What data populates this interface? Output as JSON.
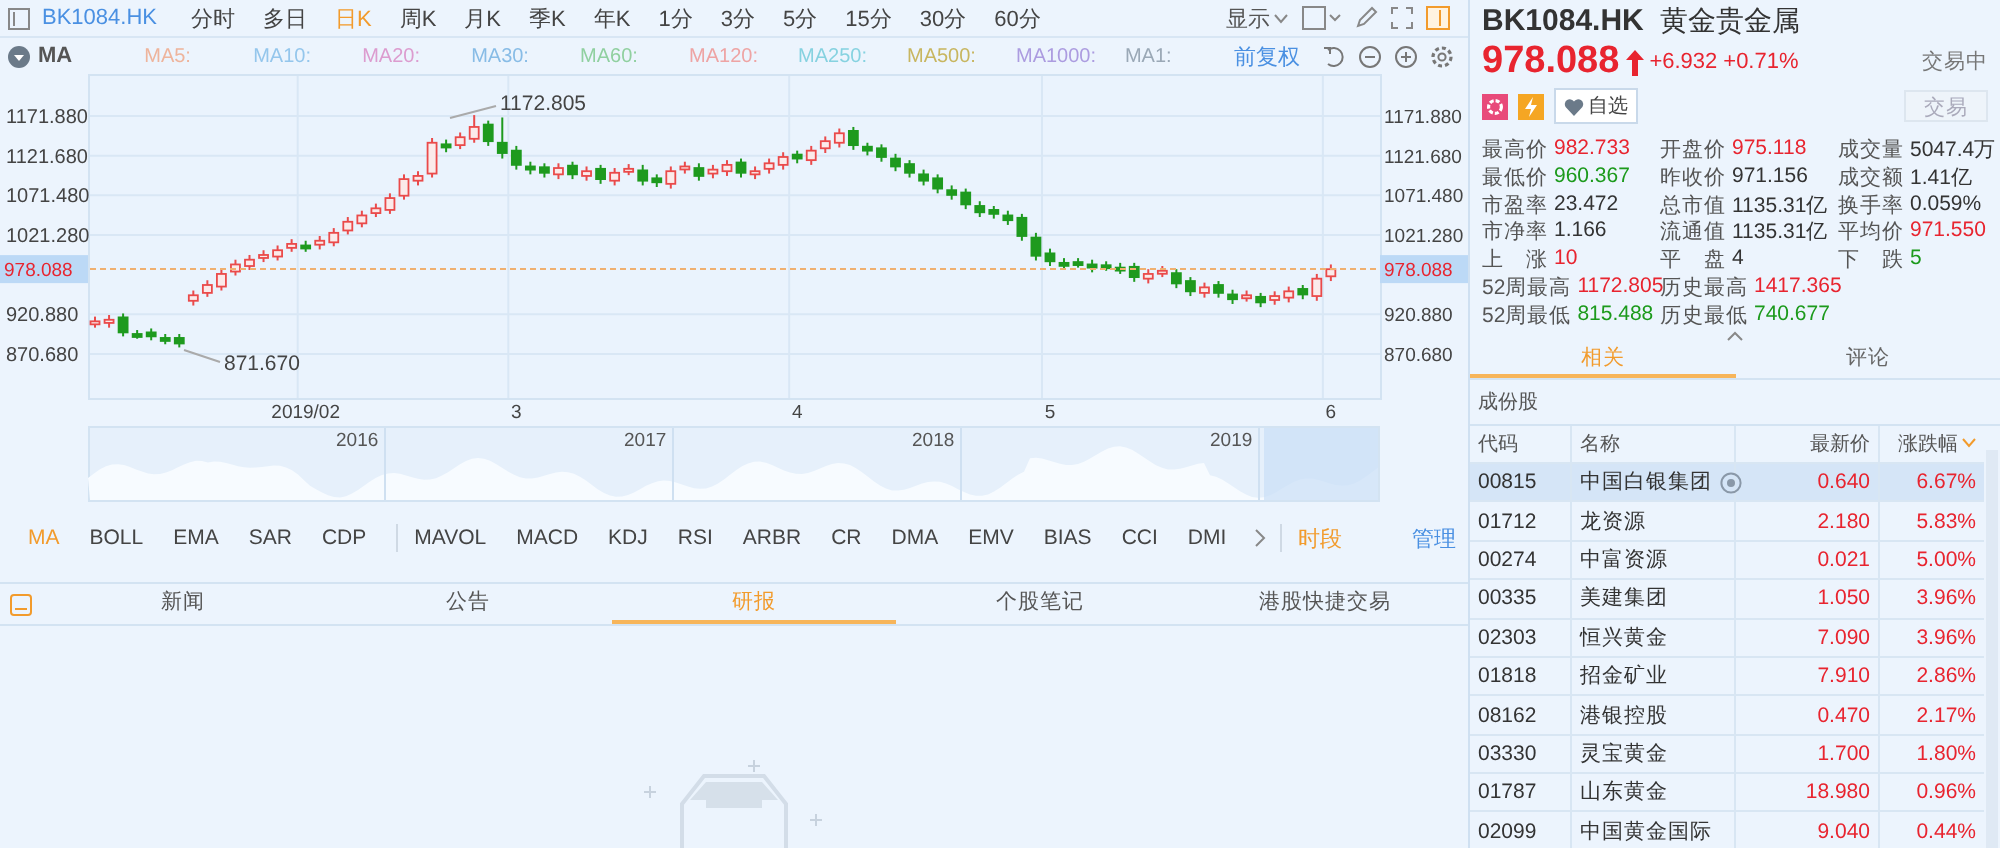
{
  "toolbar": {
    "symbol": "BK1084.HK",
    "periods": [
      {
        "label": "分时",
        "selected": false
      },
      {
        "label": "多日",
        "selected": false
      },
      {
        "label": "日K",
        "selected": true
      },
      {
        "label": "周K",
        "selected": false
      },
      {
        "label": "月K",
        "selected": false
      },
      {
        "label": "季K",
        "selected": false
      },
      {
        "label": "年K",
        "selected": false
      },
      {
        "label": "1分",
        "selected": false
      },
      {
        "label": "3分",
        "selected": false
      },
      {
        "label": "5分",
        "selected": false
      },
      {
        "label": "15分",
        "selected": false
      },
      {
        "label": "30分",
        "selected": false
      },
      {
        "label": "60分",
        "selected": false
      }
    ],
    "display_menu": "显示"
  },
  "ma_legend": {
    "label": "MA",
    "adjust": "前复权",
    "items": [
      {
        "label": "MA5:",
        "color": "#eeb49c"
      },
      {
        "label": "MA10:",
        "color": "#94c6ec"
      },
      {
        "label": "MA20:",
        "color": "#dc9ccf"
      },
      {
        "label": "MA30:",
        "color": "#88bce6"
      },
      {
        "label": "MA60:",
        "color": "#90d0a0"
      },
      {
        "label": "MA120:",
        "color": "#eea4a4"
      },
      {
        "label": "MA250:",
        "color": "#86d2e0"
      },
      {
        "label": "MA500:",
        "color": "#c8b660"
      },
      {
        "label": "MA1000:",
        "color": "#ac9ce0"
      },
      {
        "label": "MA1:",
        "color": "#9aa8b6"
      }
    ]
  },
  "chart": {
    "high_label": "1172.805",
    "low_label": "871.670",
    "price_tags": [
      "978.088",
      "978.088"
    ],
    "right_axis_labels": [
      "1171.880",
      "1121.680",
      "1071.480",
      "1021.280",
      "920.880",
      "870.680"
    ],
    "chart_data": {
      "type": "candlestick",
      "categories": [
        null,
        null,
        null,
        null,
        null,
        null,
        null,
        null,
        null,
        null,
        null,
        null,
        null,
        null,
        null,
        "2019/02",
        null,
        null,
        null,
        null,
        null,
        null,
        null,
        null,
        null,
        null,
        null,
        null,
        null,
        null,
        "3",
        null,
        null,
        null,
        null,
        null,
        null,
        null,
        null,
        null,
        null,
        null,
        null,
        null,
        null,
        null,
        null,
        null,
        null,
        null,
        "4",
        null,
        null,
        null,
        null,
        null,
        null,
        null,
        null,
        null,
        null,
        null,
        null,
        null,
        null,
        null,
        null,
        null,
        "5",
        null,
        null,
        null,
        null,
        null,
        null,
        null,
        null,
        null,
        null,
        null,
        null,
        null,
        null,
        null,
        null,
        null,
        null,
        null,
        "6"
      ],
      "ylim": [
        815.0,
        1225.0
      ],
      "grid": true,
      "ref_lines": [
        {
          "axis": "y",
          "value": 978.088,
          "color": "#f0b070"
        }
      ],
      "ohlc": [
        [
          910,
          918,
          904,
          912
        ],
        [
          910,
          920,
          904,
          914
        ],
        [
          917,
          922,
          893,
          898
        ],
        [
          896,
          901,
          890,
          895
        ],
        [
          898,
          903,
          888,
          893
        ],
        [
          891,
          896,
          883,
          888
        ],
        [
          891,
          896,
          879,
          884
        ],
        [
          938,
          951,
          932,
          945
        ],
        [
          948,
          964,
          943,
          958
        ],
        [
          956,
          978,
          951,
          972
        ],
        [
          975,
          990,
          970,
          984
        ],
        [
          982,
          996,
          977,
          990
        ],
        [
          993,
          1002,
          987,
          996
        ],
        [
          994,
          1008,
          989,
          1002
        ],
        [
          1005,
          1016,
          1000,
          1010
        ],
        [
          1008,
          1014,
          1000,
          1006
        ],
        [
          1009,
          1020,
          1003,
          1014
        ],
        [
          1012,
          1030,
          1007,
          1024
        ],
        [
          1027,
          1044,
          1022,
          1038
        ],
        [
          1036,
          1052,
          1031,
          1046
        ],
        [
          1049,
          1061,
          1044,
          1055
        ],
        [
          1053,
          1074,
          1048,
          1068
        ],
        [
          1071,
          1098,
          1066,
          1092
        ],
        [
          1090,
          1102,
          1084,
          1096
        ],
        [
          1099,
          1144,
          1094,
          1138
        ],
        [
          1136,
          1142,
          1126,
          1132
        ],
        [
          1135,
          1151,
          1130,
          1145
        ],
        [
          1143,
          1173,
          1138,
          1158
        ],
        [
          1161,
          1166,
          1134,
          1140
        ],
        [
          1138,
          1170,
          1118,
          1125
        ],
        [
          1128,
          1134,
          1104,
          1110
        ],
        [
          1108,
          1114,
          1098,
          1104
        ],
        [
          1107,
          1112,
          1094,
          1100
        ],
        [
          1098,
          1112,
          1092,
          1106
        ],
        [
          1109,
          1114,
          1092,
          1098
        ],
        [
          1096,
          1108,
          1090,
          1102
        ],
        [
          1105,
          1110,
          1086,
          1092
        ],
        [
          1090,
          1106,
          1084,
          1100
        ],
        [
          1103,
          1111,
          1097,
          1105
        ],
        [
          1103,
          1110,
          1084,
          1090
        ],
        [
          1093,
          1098,
          1082,
          1088
        ],
        [
          1086,
          1108,
          1080,
          1102
        ],
        [
          1105,
          1114,
          1099,
          1108
        ],
        [
          1106,
          1112,
          1090,
          1096
        ],
        [
          1099,
          1110,
          1093,
          1104
        ],
        [
          1102,
          1116,
          1096,
          1110
        ],
        [
          1113,
          1118,
          1094,
          1100
        ],
        [
          1098,
          1108,
          1092,
          1102
        ],
        [
          1105,
          1118,
          1099,
          1112
        ],
        [
          1110,
          1126,
          1104,
          1120
        ],
        [
          1123,
          1128,
          1112,
          1118
        ],
        [
          1116,
          1134,
          1110,
          1128
        ],
        [
          1131,
          1146,
          1125,
          1140
        ],
        [
          1138,
          1156,
          1132,
          1150
        ],
        [
          1153,
          1158,
          1129,
          1135
        ],
        [
          1133,
          1138,
          1122,
          1128
        ],
        [
          1131,
          1136,
          1114,
          1120
        ],
        [
          1118,
          1124,
          1102,
          1108
        ],
        [
          1111,
          1116,
          1094,
          1100
        ],
        [
          1098,
          1104,
          1084,
          1090
        ],
        [
          1093,
          1098,
          1074,
          1080
        ],
        [
          1078,
          1084,
          1066,
          1072
        ],
        [
          1075,
          1080,
          1054,
          1060
        ],
        [
          1058,
          1064,
          1044,
          1050
        ],
        [
          1053,
          1058,
          1042,
          1048
        ],
        [
          1046,
          1052,
          1034,
          1040
        ],
        [
          1043,
          1048,
          1014,
          1020
        ],
        [
          1018,
          1024,
          989,
          995
        ],
        [
          998,
          1004,
          982,
          988
        ],
        [
          986,
          992,
          978,
          984
        ],
        [
          987,
          992,
          980,
          986
        ],
        [
          984,
          990,
          974,
          980
        ],
        [
          983,
          988,
          976,
          982
        ],
        [
          980,
          986,
          972,
          978
        ],
        [
          981,
          986,
          962,
          968
        ],
        [
          966,
          978,
          960,
          972
        ],
        [
          974,
          982,
          968,
          976
        ],
        [
          973,
          978,
          954,
          960
        ],
        [
          963,
          968,
          944,
          950
        ],
        [
          948,
          961,
          942,
          955
        ],
        [
          958,
          963,
          942,
          948
        ],
        [
          946,
          952,
          934,
          940
        ],
        [
          943,
          951,
          937,
          945
        ],
        [
          943,
          948,
          930,
          936
        ],
        [
          939,
          950,
          933,
          944
        ],
        [
          942,
          956,
          936,
          950
        ],
        [
          953,
          958,
          940,
          946
        ],
        [
          944,
          972,
          938,
          966
        ],
        [
          969,
          984,
          963,
          978
        ]
      ],
      "yticks": [
        {
          "value": 1171.88,
          "label": "1171.880"
        },
        {
          "value": 1121.68,
          "label": "1121.680"
        },
        {
          "value": 1071.48,
          "label": "1071.480"
        },
        {
          "value": 1021.28,
          "label": "1021.280"
        },
        {
          "value": 920.88,
          "label": "920.880"
        },
        {
          "value": 870.68,
          "label": "870.680"
        }
      ]
    }
  },
  "navigator": {
    "years": [
      "2016",
      "2017",
      "2018",
      "2019"
    ]
  },
  "indicators": {
    "items": [
      {
        "label": "MA",
        "selected": true
      },
      {
        "label": "BOLL",
        "selected": false
      },
      {
        "label": "EMA",
        "selected": false
      },
      {
        "label": "SAR",
        "selected": false
      },
      {
        "label": "CDP",
        "selected": false
      },
      {
        "label": "MAVOL",
        "selected": false
      },
      {
        "label": "MACD",
        "selected": false
      },
      {
        "label": "KDJ",
        "selected": false
      },
      {
        "label": "RSI",
        "selected": false
      },
      {
        "label": "ARBR",
        "selected": false
      },
      {
        "label": "CR",
        "selected": false
      },
      {
        "label": "DMA",
        "selected": false
      },
      {
        "label": "EMV",
        "selected": false
      },
      {
        "label": "BIAS",
        "selected": false
      },
      {
        "label": "CCI",
        "selected": false
      },
      {
        "label": "DMI",
        "selected": false
      }
    ],
    "time_segment": "时段",
    "manage": "管理"
  },
  "bottom_tabs": [
    {
      "label": "新闻",
      "selected": false
    },
    {
      "label": "公告",
      "selected": false
    },
    {
      "label": "研报",
      "selected": true
    },
    {
      "label": "个股笔记",
      "selected": false
    },
    {
      "label": "港股快捷交易",
      "selected": false
    }
  ],
  "quote": {
    "code": "BK1084.HK",
    "name": "黄金贵金属",
    "price": "978.088",
    "change": "+6.932",
    "change_pct": "+0.71%",
    "status": "交易中",
    "watchlist": "自选",
    "trade_button": "交易"
  },
  "stats": [
    [
      {
        "label": "最高价",
        "value": "982.733",
        "color": "#e8242f"
      },
      {
        "label": "开盘价",
        "value": "975.118",
        "color": "#e8242f"
      },
      {
        "label": "成交量",
        "value": "5047.4万"
      }
    ],
    [
      {
        "label": "最低价",
        "value": "960.367",
        "color": "#1c9a1c"
      },
      {
        "label": "昨收价",
        "value": "971.156"
      },
      {
        "label": "成交额",
        "value": "1.41亿"
      }
    ],
    [
      {
        "label": "市盈率",
        "value": "23.472"
      },
      {
        "label": "总市值",
        "value": "1135.31亿"
      },
      {
        "label": "换手率",
        "value": "0.059%"
      }
    ],
    [
      {
        "label": "市净率",
        "value": "1.166"
      },
      {
        "label": "流通值",
        "value": "1135.31亿"
      },
      {
        "label": "平均价",
        "value": "971.550",
        "color": "#e8242f"
      }
    ],
    [
      {
        "label": "上　涨",
        "value": "10",
        "color": "#e8242f"
      },
      {
        "label": "平　盘",
        "value": "4"
      },
      {
        "label": "下　跌",
        "value": "5",
        "color": "#1c9a1c"
      }
    ],
    [
      {
        "label": "52周最高",
        "value": "1172.805",
        "color": "#e8242f"
      },
      {
        "label": "历史最高",
        "value": "1417.365",
        "color": "#e8242f"
      }
    ],
    [
      {
        "label": "52周最低",
        "value": "815.488",
        "color": "#1c9a1c"
      },
      {
        "label": "历史最低",
        "value": "740.677",
        "color": "#1c9a1c"
      }
    ]
  ],
  "related_tabs": [
    {
      "label": "相关",
      "selected": true
    },
    {
      "label": "评论",
      "selected": false
    }
  ],
  "constituents": {
    "title": "成份股",
    "columns": [
      "代码",
      "名称",
      "最新价",
      "涨跌幅"
    ],
    "rows": [
      {
        "code": "00815",
        "name": "中国白银集团",
        "price": "0.640",
        "change": "6.67%",
        "selected": true
      },
      {
        "code": "01712",
        "name": "龙资源",
        "price": "2.180",
        "change": "5.83%",
        "selected": false
      },
      {
        "code": "00274",
        "name": "中富资源",
        "price": "0.021",
        "change": "5.00%",
        "selected": false
      },
      {
        "code": "00335",
        "name": "美建集团",
        "price": "1.050",
        "change": "3.96%",
        "selected": false
      },
      {
        "code": "02303",
        "name": "恒兴黄金",
        "price": "7.090",
        "change": "3.96%",
        "selected": false
      },
      {
        "code": "01818",
        "name": "招金矿业",
        "price": "7.910",
        "change": "2.86%",
        "selected": false
      },
      {
        "code": "08162",
        "name": "港银控股",
        "price": "0.470",
        "change": "2.17%",
        "selected": false
      },
      {
        "code": "03330",
        "name": "灵宝黄金",
        "price": "1.700",
        "change": "1.80%",
        "selected": false
      },
      {
        "code": "01787",
        "name": "山东黄金",
        "price": "18.980",
        "change": "0.96%",
        "selected": false
      },
      {
        "code": "02099",
        "name": "中国黄金国际",
        "price": "9.040",
        "change": "0.44%",
        "selected": false
      }
    ]
  }
}
